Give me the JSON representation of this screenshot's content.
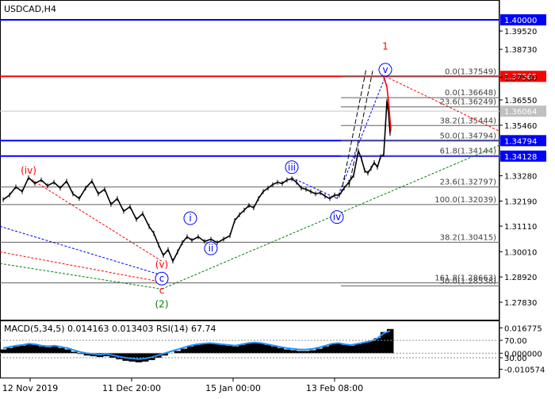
{
  "chart_data": [
    {
      "type": "line",
      "title": "USDCAD,H4",
      "y_axis": {
        "ylim": [
          1.2725,
          1.4065
        ],
        "ticks": [
          "1.39520",
          "1.38730",
          "1.37530",
          "1.36550",
          "1.35460",
          "1.33280",
          "1.32190",
          "1.31110",
          "1.30010",
          "1.28920",
          "1.27830"
        ]
      },
      "x_axis": {
        "xlim": [
          0,
          700
        ],
        "ticks": [
          {
            "x": 38,
            "label": "12 Nov 2019"
          },
          {
            "x": 166,
            "label": "11 Dec 20:00"
          },
          {
            "x": 294,
            "label": "15 Jan 00:00"
          },
          {
            "x": 422,
            "label": "13 Feb 08:00"
          }
        ]
      },
      "series": [
        {
          "name": "",
          "color": "#000000",
          "points": [
            [
              4,
              1.3225
            ],
            [
              12,
              1.3245
            ],
            [
              20,
              1.328
            ],
            [
              28,
              1.326
            ],
            [
              36,
              1.332
            ],
            [
              44,
              1.3295
            ],
            [
              52,
              1.331
            ],
            [
              60,
              1.3285
            ],
            [
              68,
              1.33
            ],
            [
              76,
              1.3275
            ],
            [
              84,
              1.3305
            ],
            [
              92,
              1.325
            ],
            [
              100,
              1.323
            ],
            [
              108,
              1.3275
            ],
            [
              116,
              1.3305
            ],
            [
              124,
              1.325
            ],
            [
              132,
              1.327
            ],
            [
              140,
              1.3205
            ],
            [
              148,
              1.323
            ],
            [
              156,
              1.3175
            ],
            [
              164,
              1.3195
            ],
            [
              172,
              1.314
            ],
            [
              180,
              1.3165
            ],
            [
              188,
              1.311
            ],
            [
              194,
              1.308
            ],
            [
              200,
              1.303
            ],
            [
              206,
              1.2985
            ],
            [
              212,
              1.301
            ],
            [
              218,
              1.296
            ],
            [
              224,
              1.3
            ],
            [
              230,
              1.304
            ],
            [
              236,
              1.3065
            ],
            [
              242,
              1.305
            ],
            [
              250,
              1.3065
            ],
            [
              258,
              1.3045
            ],
            [
              266,
              1.3055
            ],
            [
              274,
              1.304
            ],
            [
              282,
              1.3055
            ],
            [
              290,
              1.307
            ],
            [
              296,
              1.3135
            ],
            [
              302,
              1.316
            ],
            [
              308,
              1.318
            ],
            [
              314,
              1.32
            ],
            [
              320,
              1.319
            ],
            [
              326,
              1.323
            ],
            [
              332,
              1.326
            ],
            [
              338,
              1.3275
            ],
            [
              344,
              1.329
            ],
            [
              350,
              1.33
            ],
            [
              356,
              1.3295
            ],
            [
              362,
              1.331
            ],
            [
              368,
              1.3315
            ],
            [
              374,
              1.33
            ],
            [
              380,
              1.3275
            ],
            [
              386,
              1.327
            ],
            [
              392,
              1.326
            ],
            [
              398,
              1.325
            ],
            [
              404,
              1.3255
            ],
            [
              410,
              1.324
            ],
            [
              416,
              1.323
            ],
            [
              422,
              1.3245
            ],
            [
              428,
              1.3245
            ],
            [
              434,
              1.3275
            ],
            [
              440,
              1.33
            ],
            [
              446,
              1.333
            ],
            [
              452,
              1.3435
            ],
            [
              456,
              1.34
            ],
            [
              460,
              1.335
            ],
            [
              464,
              1.334
            ],
            [
              468,
              1.336
            ],
            [
              472,
              1.3385
            ],
            [
              476,
              1.3365
            ],
            [
              480,
              1.341
            ],
            [
              484,
              1.342
            ],
            [
              488,
              1.365
            ],
            [
              490,
              1.36
            ],
            [
              492,
              1.351
            ]
          ]
        },
        {
          "name": "",
          "color": "#ff0000",
          "points": [
            [
              484,
              1.3756
            ],
            [
              488,
              1.371
            ],
            [
              490,
              1.365
            ],
            [
              492,
              1.3565
            ],
            [
              493,
              1.353
            ]
          ]
        }
      ],
      "horizontal_levels": [
        {
          "value": 1.4,
          "label": "1.40000",
          "color": "#0000ff",
          "style": "solid"
        },
        {
          "value": 1.37565,
          "label": "1.37565",
          "color": "#ff0000",
          "style": "solid"
        },
        {
          "value": 1.36064,
          "label": "1.36064",
          "color": "#c8c8c8",
          "style": "solid"
        },
        {
          "value": 1.34794,
          "label": "1.34794",
          "color": "#0000ff",
          "style": "solid"
        },
        {
          "value": 1.34128,
          "label": "1.34128",
          "color": "#0000ff",
          "style": "solid"
        }
      ],
      "fibonacci_levels": [
        {
          "value": 1.37549,
          "label": "0.0(1.37549)"
        },
        {
          "value": 1.36648,
          "label": "0.0(1.36648)"
        },
        {
          "value": 1.36249,
          "label": "23.6(1.36249)"
        },
        {
          "value": 1.35444,
          "label": "38.2(1.35444)"
        },
        {
          "value": 1.34794,
          "label": "50.0(1.34794)"
        },
        {
          "value": 1.34144,
          "label": "61.8(1.34144)"
        },
        {
          "value": 1.32797,
          "label": "23.6(1.32797)"
        },
        {
          "value": 1.32039,
          "label": "100.0(1.32039)"
        },
        {
          "value": 1.30415,
          "label": "38.2(1.30415)"
        },
        {
          "value": 1.28663,
          "label": "161.8(1.28663)"
        },
        {
          "value": 1.28538,
          "label": "50.0(1.28538)"
        }
      ],
      "wave_labels": [
        {
          "text": "1",
          "x": 486,
          "y": 1.3885,
          "color": "#ff0000",
          "circled": false
        },
        {
          "text": "v",
          "x": 486,
          "y": 1.3785,
          "color": "#0000ff",
          "circled": true
        },
        {
          "text": "(iv)",
          "x": 36,
          "y": 1.335,
          "color": "#ff0000",
          "circled": false
        },
        {
          "text": "iii",
          "x": 368,
          "y": 1.3365,
          "color": "#0000ff",
          "circled": true
        },
        {
          "text": "iv",
          "x": 425,
          "y": 1.315,
          "color": "#0000ff",
          "circled": true
        },
        {
          "text": "i",
          "x": 240,
          "y": 1.3145,
          "color": "#0000ff",
          "circled": true
        },
        {
          "text": "ii",
          "x": 266,
          "y": 1.3015,
          "color": "#0000ff",
          "circled": true
        },
        {
          "text": "(v)",
          "x": 204,
          "y": 1.2945,
          "color": "#ff0000",
          "circled": false
        },
        {
          "text": "c",
          "x": 204,
          "y": 1.2885,
          "color": "#0000ff",
          "circled": true
        },
        {
          "text": "c",
          "x": 204,
          "y": 1.2835,
          "color": "#ff0000",
          "circled": false
        },
        {
          "text": "(2)",
          "x": 204,
          "y": 1.2775,
          "color": "#008000",
          "circled": false
        }
      ]
    },
    {
      "type": "bar",
      "title": "MACD(5,34,5) 0.014163 0.013403 RSI(14) 67.74",
      "y_axis": {
        "ylim": [
          -0.014,
          0.0185
        ],
        "ticks": [
          "0.016775",
          "70.00",
          "0.000000",
          "30.00",
          "-0.010574"
        ]
      },
      "series": [
        {
          "name": "",
          "values": [
            0.0025,
            0.0035,
            0.0045,
            0.005,
            0.006,
            0.0055,
            0.0045,
            0.004,
            0.0045,
            0.0035,
            0.0025,
            0.001,
            -0.0005,
            -0.0015,
            -0.002,
            -0.0025,
            -0.002,
            -0.003,
            -0.004,
            -0.005,
            -0.0055,
            -0.006,
            -0.0055,
            -0.0045,
            -0.003,
            -0.0015,
            0.0,
            0.0015,
            0.003,
            0.0045,
            0.0055,
            0.006,
            0.0065,
            0.006,
            0.0055,
            0.005,
            0.0045,
            0.0055,
            0.0065,
            0.007,
            0.0065,
            0.0055,
            0.0045,
            0.0035,
            0.0025,
            0.002,
            0.0015,
            0.0015,
            0.002,
            0.003,
            0.0045,
            0.006,
            0.0065,
            0.0055,
            0.005,
            0.006,
            0.007,
            0.008,
            0.01,
            0.014,
            0.016
          ]
        }
      ]
    }
  ]
}
